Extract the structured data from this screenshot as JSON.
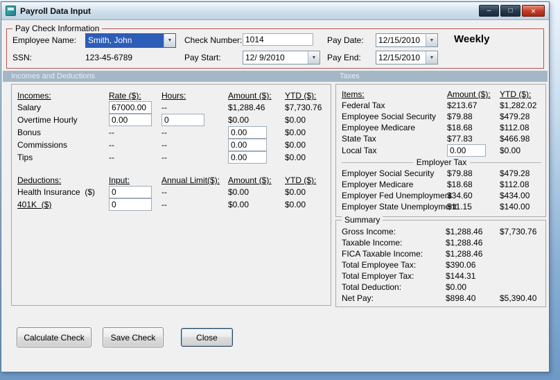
{
  "window": {
    "title": "Payroll Data Input",
    "minimize_glyph": "–",
    "maximize_glyph": "□",
    "close_glyph": "×"
  },
  "icons": {
    "dropdown_glyph": "▼"
  },
  "paycheck": {
    "legend": "Pay Check Information",
    "employee_name_label": "Employee Name:",
    "employee_name_value": "Smith, John",
    "ssn_label": "SSN:",
    "ssn_value": "123-45-6789",
    "check_number_label": "Check Number:",
    "check_number_value": "1014",
    "pay_start_label": "Pay Start:",
    "pay_start_value": "12/ 9/2010",
    "pay_date_label": "Pay Date:",
    "pay_date_value": "12/15/2010",
    "pay_end_label": "Pay End:",
    "pay_end_value": "12/15/2010",
    "frequency": "Weekly"
  },
  "sections": {
    "incomes_deductions": "Incomes and Deductions",
    "taxes": "Taxes"
  },
  "incomes": {
    "headers": {
      "name": "Incomes:",
      "rate": "Rate ($):",
      "hours": "Hours:",
      "amount": "Amount ($):",
      "ytd": "YTD ($):"
    },
    "rows": [
      {
        "label": "Salary",
        "rate_input": "67000.00",
        "hours": "--",
        "amount": "$1,288.46",
        "ytd": "$7,730.76"
      },
      {
        "label": "Overtime Hourly",
        "rate_input": "0.00",
        "hours_input": "0",
        "amount": "$0.00",
        "ytd": "$0.00"
      },
      {
        "label": "Bonus",
        "rate": "--",
        "hours": "--",
        "amount_input": "0.00",
        "ytd": "$0.00"
      },
      {
        "label": "Commissions",
        "rate": "--",
        "hours": "--",
        "amount_input": "0.00",
        "ytd": "$0.00"
      },
      {
        "label": "Tips",
        "rate": "--",
        "hours": "--",
        "amount_input": "0.00",
        "ytd": "$0.00"
      }
    ]
  },
  "deductions": {
    "headers": {
      "name": "Deductions:",
      "input": "Input:",
      "limit": "Annual Limit($):",
      "amount": "Amount ($):",
      "ytd": "YTD ($):"
    },
    "rows": [
      {
        "label": "Health Insurance  ($)",
        "input": "0",
        "limit": "--",
        "amount": "$0.00",
        "ytd": "$0.00"
      },
      {
        "label": "401K  ($)",
        "input": "0",
        "limit": "--",
        "amount": "$0.00",
        "ytd": "$0.00"
      }
    ]
  },
  "taxes": {
    "headers": {
      "items": "Items:",
      "amount": "Amount ($):",
      "ytd": "YTD ($):"
    },
    "employee_rows": [
      {
        "label": "Federal Tax",
        "amount": "$213.67",
        "ytd": "$1,282.02"
      },
      {
        "label": "Employee Social Security",
        "amount": "$79.88",
        "ytd": "$479.28"
      },
      {
        "label": "Employee Medicare",
        "amount": "$18.68",
        "ytd": "$112.08"
      },
      {
        "label": "State Tax",
        "amount": "$77.83",
        "ytd": "$466.98"
      },
      {
        "label": "Local Tax",
        "amount_input": "0.00",
        "ytd": "$0.00"
      }
    ],
    "employer_header": "Employer Tax",
    "employer_rows": [
      {
        "label": "Employer Social Security",
        "amount": "$79.88",
        "ytd": "$479.28"
      },
      {
        "label": "Employer Medicare",
        "amount": "$18.68",
        "ytd": "$112.08"
      },
      {
        "label": "Employer Fed Unemployment",
        "amount": "$34.60",
        "ytd": "$434.00"
      },
      {
        "label": "Employer State Unemployment",
        "amount": "$11.15",
        "ytd": "$140.00"
      }
    ]
  },
  "summary": {
    "legend": "Summary",
    "rows": [
      {
        "label": "Gross Income:",
        "value": "$1,288.46",
        "ytd": "$7,730.76"
      },
      {
        "label": "Taxable Income:",
        "value": "$1,288.46",
        "ytd": ""
      },
      {
        "label": "FICA Taxable Income:",
        "value": "$1,288.46",
        "ytd": ""
      },
      {
        "label": "Total Employee Tax:",
        "value": "$390.06",
        "ytd": ""
      },
      {
        "label": "Total Employer Tax:",
        "value": "$144.31",
        "ytd": ""
      },
      {
        "label": "Total Deduction:",
        "value": "$0.00",
        "ytd": ""
      },
      {
        "label": "Net Pay:",
        "value": "$898.40",
        "ytd": "$5,390.40"
      }
    ]
  },
  "buttons": {
    "calculate": "Calculate Check",
    "save": "Save Check",
    "close": "Close"
  }
}
